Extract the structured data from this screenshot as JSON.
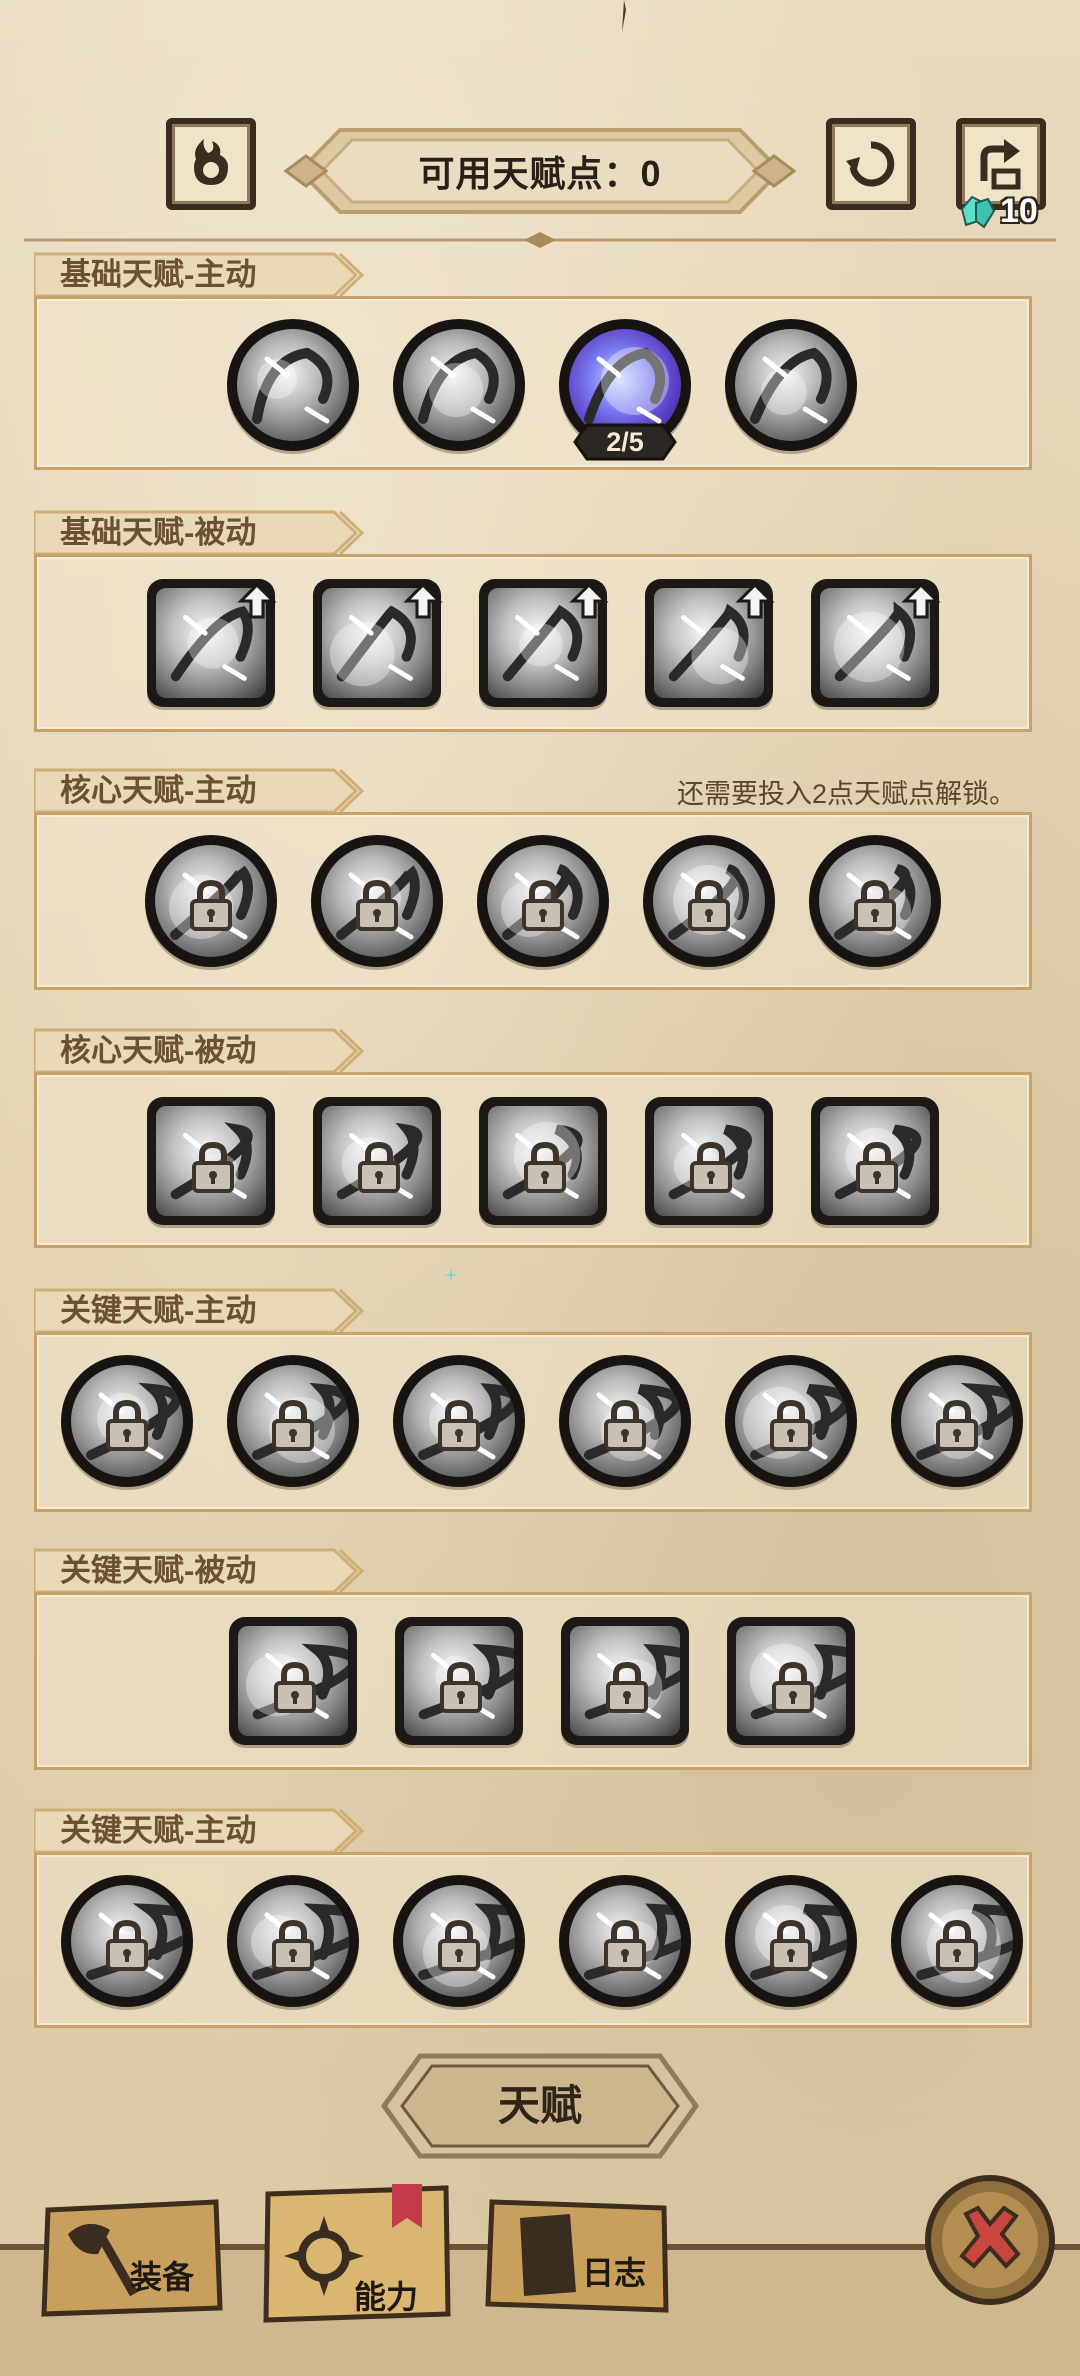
{
  "header": {
    "available_points_label": "可用天赋点：0",
    "gem_count": "10",
    "left_button_icon": "flame-pot-icon",
    "reset_button_icon": "reset-icon",
    "share_button_icon": "export-icon"
  },
  "sections": [
    {
      "title": "基础天赋-主动",
      "hint": "",
      "shape": "circle",
      "count": 4,
      "locked": false,
      "upgraded_index": 2,
      "upgraded_level": "2/5"
    },
    {
      "title": "基础天赋-被动",
      "hint": "",
      "shape": "square",
      "count": 5,
      "locked": false
    },
    {
      "title": "核心天赋-主动",
      "hint": "还需要投入2点天赋点解锁。",
      "shape": "circle",
      "count": 5,
      "locked": true
    },
    {
      "title": "核心天赋-被动",
      "hint": "",
      "shape": "square",
      "count": 5,
      "locked": true
    },
    {
      "title": "关键天赋-主动",
      "hint": "",
      "shape": "circle",
      "count": 6,
      "locked": true
    },
    {
      "title": "关键天赋-被动",
      "hint": "",
      "shape": "square",
      "count": 4,
      "locked": true
    },
    {
      "title": "关键天赋-主动",
      "hint": "",
      "shape": "circle",
      "count": 6,
      "locked": true
    }
  ],
  "footer": {
    "talent_button": "天赋",
    "tabs": [
      {
        "label": "装备",
        "icon": "axe-icon"
      },
      {
        "label": "能力",
        "icon": "ability-icon",
        "selected": true
      },
      {
        "label": "日志",
        "icon": "journal-icon"
      }
    ],
    "close_icon": "close-icon"
  },
  "colors": {
    "parchment": "#e4d4b4",
    "frame_gold": "#c7a26a",
    "section_title": "#6a5132",
    "close_red": "#c9453d",
    "gem_teal": "#5ee0c8"
  }
}
